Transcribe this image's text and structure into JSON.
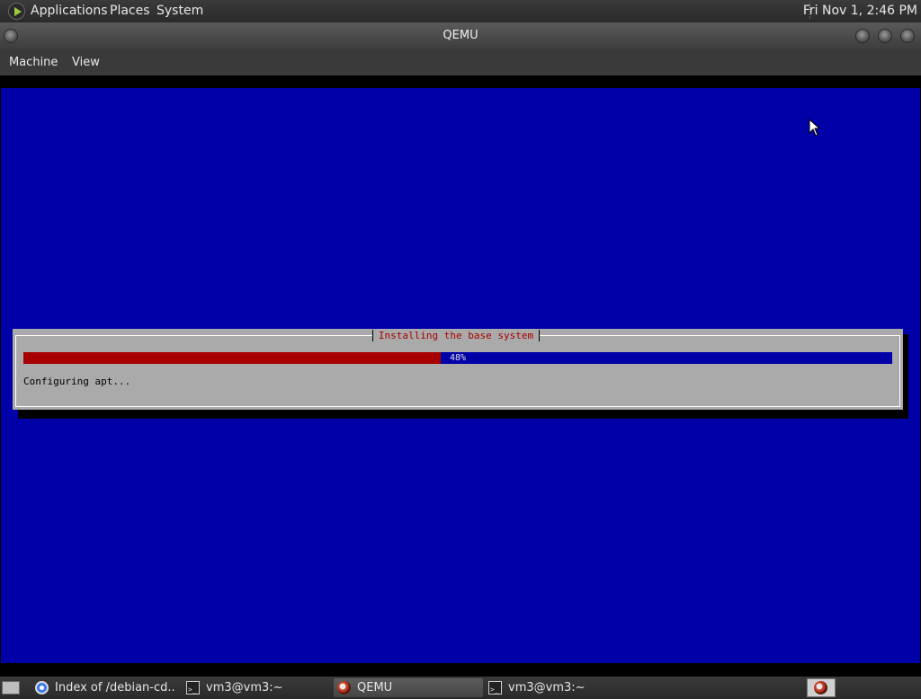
{
  "top_panel": {
    "applications": "Applications",
    "places": "Places",
    "system": "System",
    "clock": "Fri Nov 1,  2:46 PM"
  },
  "window": {
    "title": "QEMU"
  },
  "menubar": {
    "machine": "Machine",
    "view": "View"
  },
  "installer": {
    "dialog_title": "Installing the base system",
    "progress_percent": 48,
    "progress_label": "48%",
    "status": "Configuring apt..."
  },
  "taskbar": {
    "tasks": [
      {
        "label": "Index of /debian-cd...",
        "icon": "browser-icon"
      },
      {
        "label": "vm3@vm3:~",
        "icon": "terminal-icon"
      },
      {
        "label": "QEMU",
        "icon": "qemu-icon",
        "active": true
      },
      {
        "label": "vm3@vm3:~",
        "icon": "terminal-icon"
      }
    ]
  },
  "colors": {
    "vm_background": "#0000a8",
    "dialog": "#aaaaaa",
    "progress_fill": "#a80000",
    "title_text": "#a80000"
  }
}
